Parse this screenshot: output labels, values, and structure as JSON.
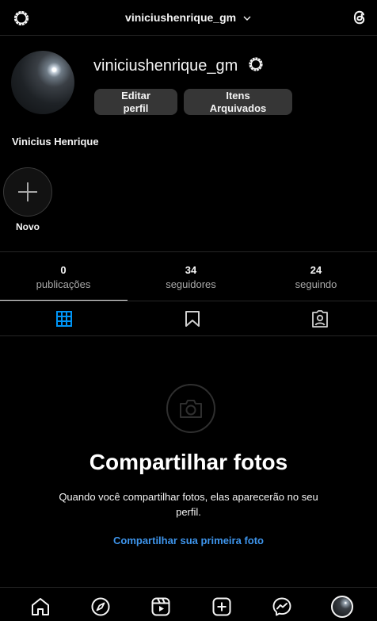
{
  "topbar": {
    "username": "viniciushenrique_gm"
  },
  "profile": {
    "username": "viniciushenrique_gm",
    "edit_profile": "Editar\nperfil",
    "archived_items": "Itens\nArquivados",
    "full_name": "Vinicius Henrique"
  },
  "highlights": {
    "new_label": "Novo"
  },
  "stats": [
    {
      "value": "0",
      "label": "publicações"
    },
    {
      "value": "34",
      "label": "seguidores"
    },
    {
      "value": "24",
      "label": "seguindo"
    }
  ],
  "tabs": [
    "grid-icon",
    "saved-icon",
    "tagged-icon"
  ],
  "colors": {
    "active_tab": "#0095f6",
    "link": "#3e95ec",
    "button_bg": "#363636"
  },
  "empty_state": {
    "title": "Compartilhar fotos",
    "description": "Quando você compartilhar fotos, elas aparecerão no seu perfil.",
    "link": "Compartilhar sua primeira foto"
  },
  "bottom_nav": [
    "home-icon",
    "explore-icon",
    "reels-icon",
    "create-icon",
    "messenger-icon",
    "profile-avatar"
  ]
}
